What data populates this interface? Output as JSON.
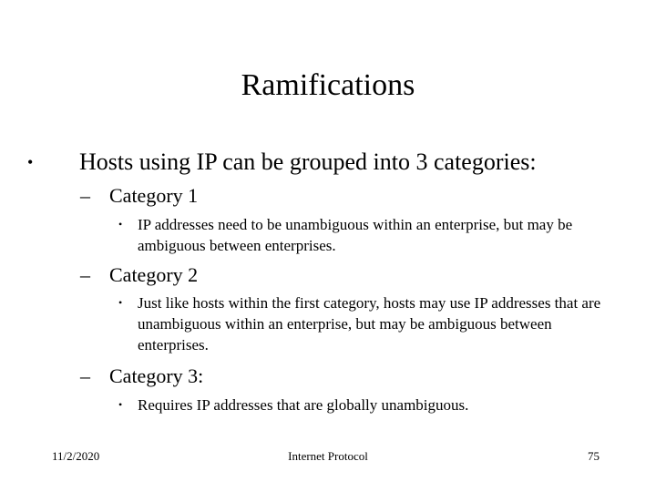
{
  "slide": {
    "title": "Ramifications",
    "main_bullet": {
      "glyph": "•",
      "text": "Hosts using IP can be grouped into 3 categories:"
    },
    "categories": [
      {
        "dash": "–",
        "label": "Category 1",
        "bullet": "•",
        "detail": "IP addresses need to be unambiguous within an enterprise, but may be ambiguous between enterprises."
      },
      {
        "dash": "–",
        "label": "Category 2",
        "bullet": "•",
        "detail": "Just like hosts within the first category, hosts may use IP addresses that are unambiguous within an  enterprise, but may be ambiguous between enterprises."
      },
      {
        "dash": "–",
        "label": "Category 3:",
        "bullet": "•",
        "detail": "Requires IP addresses that are globally unambiguous."
      }
    ]
  },
  "footer": {
    "date": "11/2/2020",
    "title": "Internet Protocol",
    "page_number": "75"
  }
}
